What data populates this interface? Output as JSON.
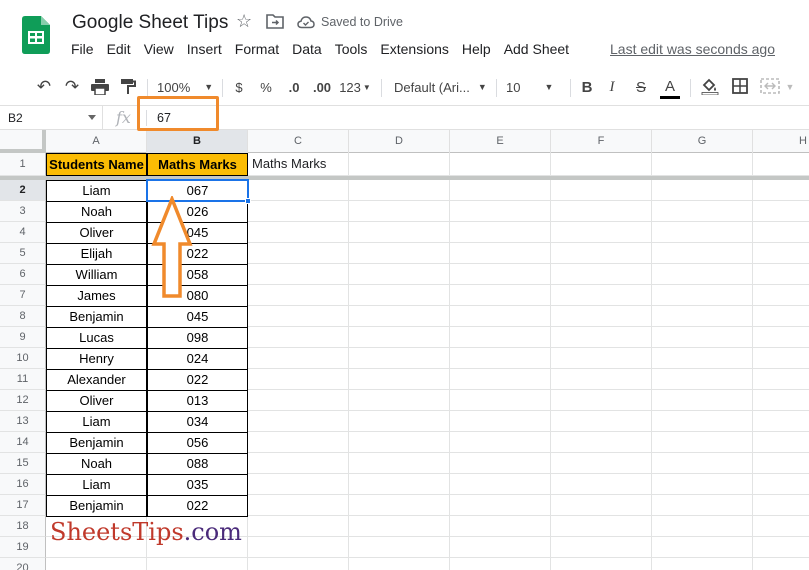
{
  "header": {
    "title": "Google Sheet Tips",
    "saved_status": "Saved to Drive",
    "last_edit": "Last edit was seconds ago",
    "menu": [
      "File",
      "Edit",
      "View",
      "Insert",
      "Format",
      "Data",
      "Tools",
      "Extensions",
      "Help",
      "Add Sheet"
    ]
  },
  "toolbar": {
    "zoom": "100%",
    "currency": "$",
    "percent": "%",
    "decrease_decimal": ".0",
    "increase_decimal": ".00",
    "more_formats": "123",
    "font": "Default (Ari...",
    "font_size": "10",
    "bold": "B",
    "italic": "I",
    "strikethrough": "S",
    "text_color": "A"
  },
  "formula_bar": {
    "cell_ref": "B2",
    "fx_label": "fx",
    "value": "67"
  },
  "columns": [
    "A",
    "B",
    "C",
    "D",
    "E",
    "F",
    "G",
    "H"
  ],
  "selected_column": "B",
  "selected_row": "2",
  "rows": [
    "1",
    "2",
    "3",
    "4",
    "5",
    "6",
    "7",
    "8",
    "9",
    "10",
    "11",
    "12",
    "13",
    "14",
    "15",
    "16",
    "17",
    "18",
    "19",
    "20"
  ],
  "table": {
    "header_a": "Students Name",
    "header_b": "Maths Marks",
    "c1_value": "Maths Marks",
    "records": [
      {
        "name": "Liam",
        "marks": "067"
      },
      {
        "name": "Noah",
        "marks": "026"
      },
      {
        "name": "Oliver",
        "marks": "045"
      },
      {
        "name": "Elijah",
        "marks": "022"
      },
      {
        "name": "William",
        "marks": "058"
      },
      {
        "name": "James",
        "marks": "080"
      },
      {
        "name": "Benjamin",
        "marks": "045"
      },
      {
        "name": "Lucas",
        "marks": "098"
      },
      {
        "name": "Henry",
        "marks": "024"
      },
      {
        "name": "Alexander",
        "marks": "022"
      },
      {
        "name": "Oliver",
        "marks": "013"
      },
      {
        "name": "Liam",
        "marks": "034"
      },
      {
        "name": "Benjamin",
        "marks": "056"
      },
      {
        "name": "Noah",
        "marks": "088"
      },
      {
        "name": "Liam",
        "marks": "035"
      },
      {
        "name": "Benjamin",
        "marks": "022"
      }
    ]
  },
  "watermark": {
    "part1": "Sheets",
    "part2": "Tips",
    "part3": ".com"
  },
  "colors": {
    "header_fill": "#fbbc04",
    "accent_orange": "#f08a2c",
    "selection_blue": "#1a73e8",
    "watermark_red": "#c0392b",
    "watermark_purple": "#4a2a7a"
  }
}
